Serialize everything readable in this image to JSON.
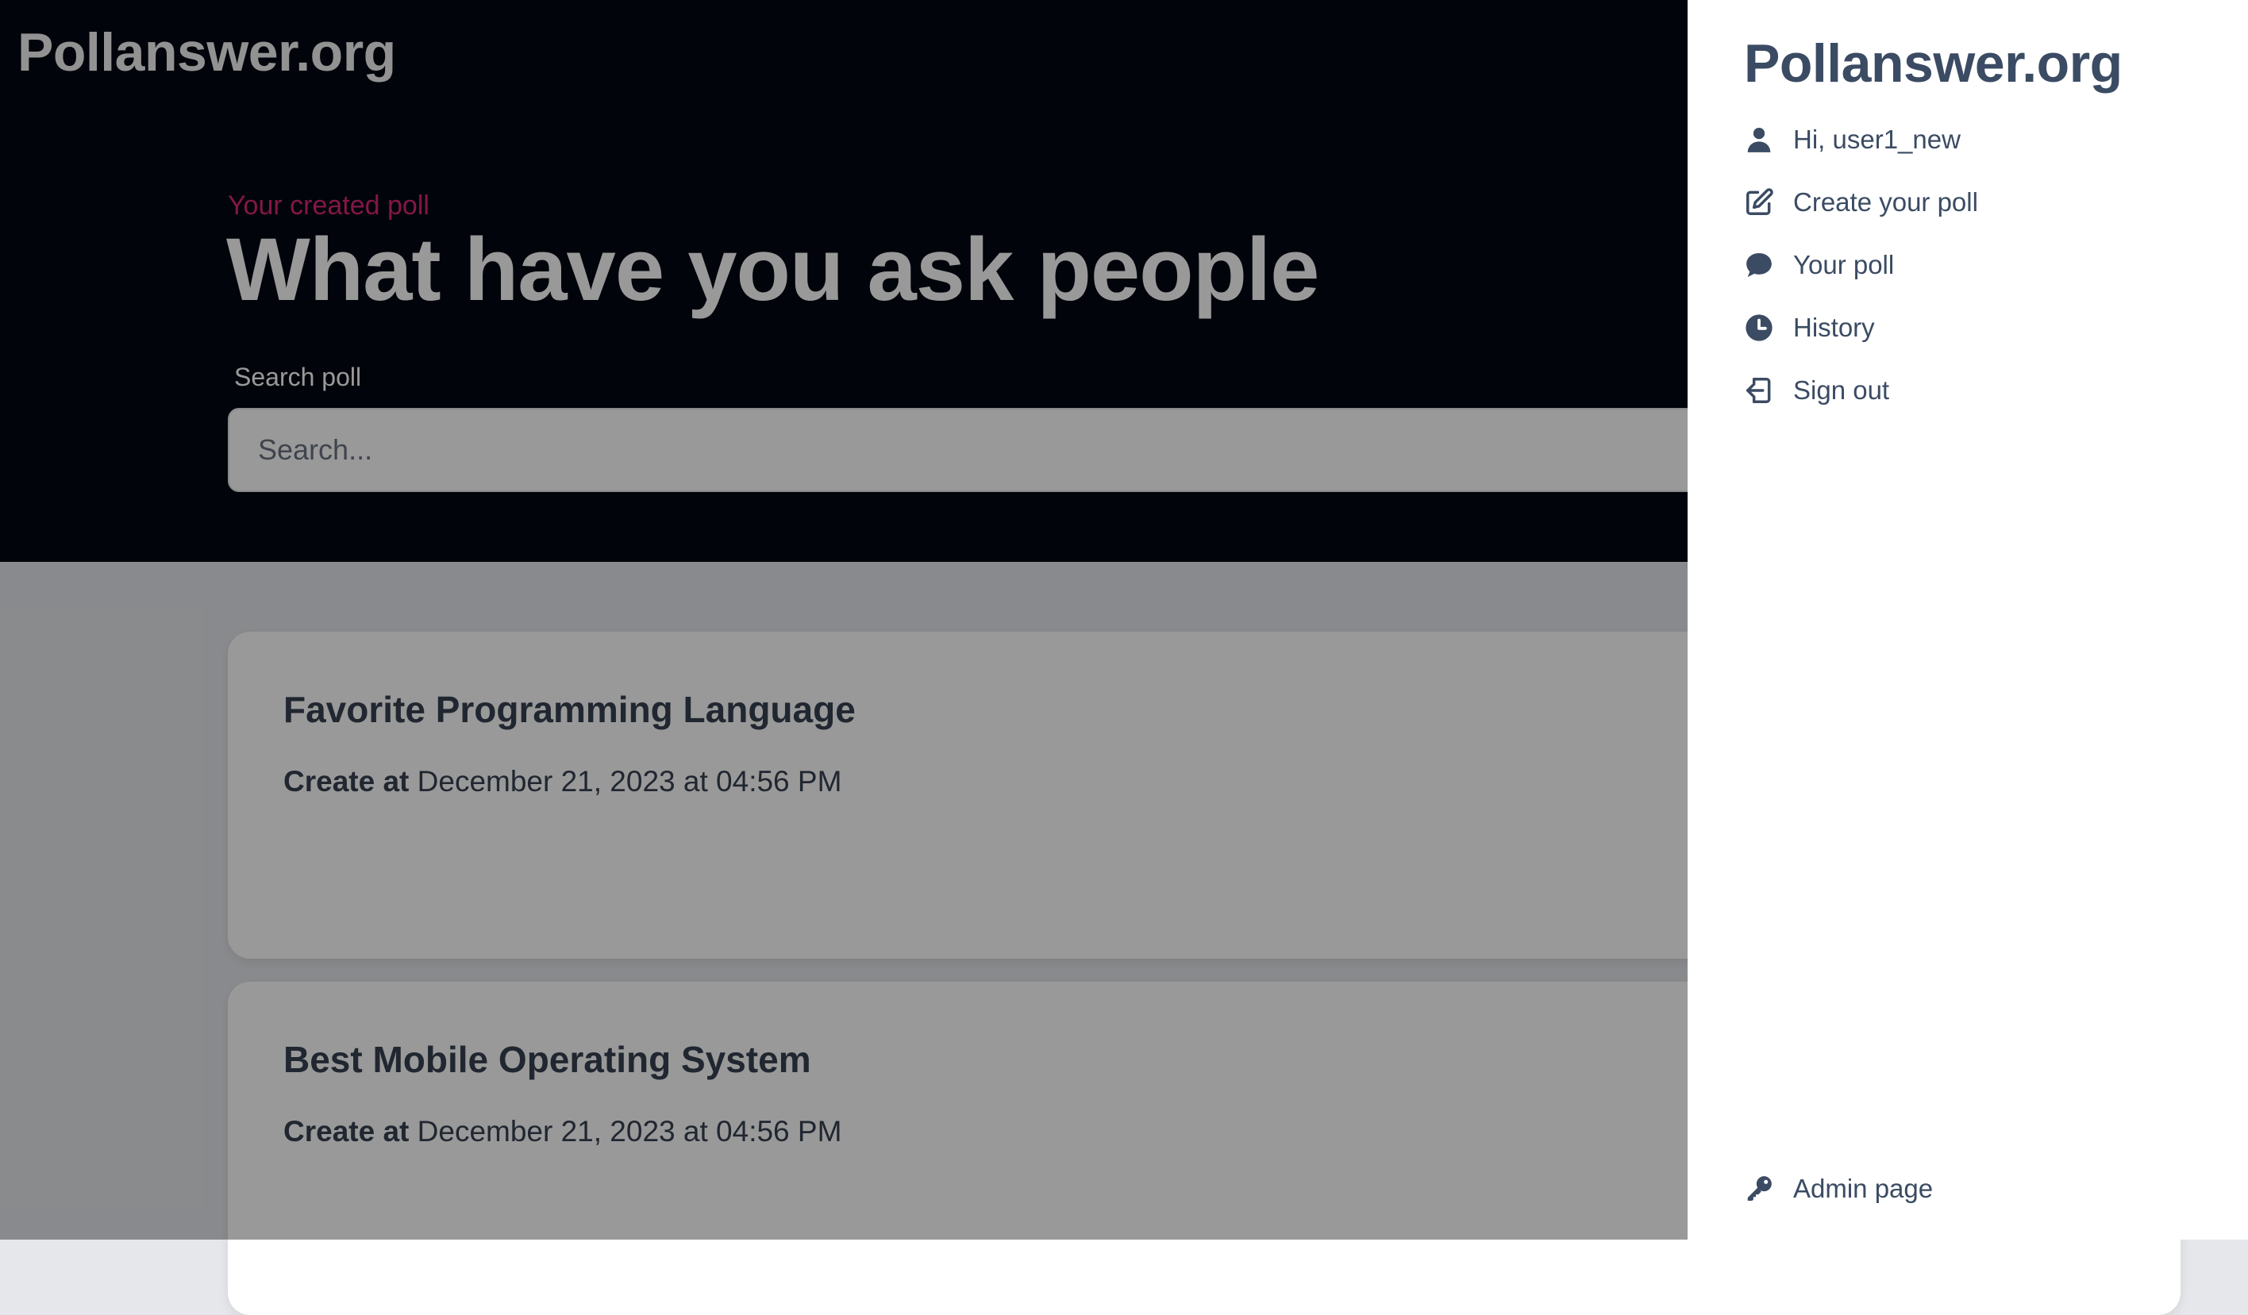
{
  "site": {
    "logo": "Pollanswer.org"
  },
  "hero": {
    "eyebrow": "Your created poll",
    "title": "What have you ask people",
    "search_label": "Search poll",
    "search_placeholder": "Search..."
  },
  "polls": [
    {
      "title": "Favorite Programming Language",
      "created_label": "Create at",
      "created_at": "December 21, 2023 at 04:56 PM"
    },
    {
      "title": "Best Mobile Operating System",
      "created_label": "Create at",
      "created_at": "December 21, 2023 at 04:56 PM"
    }
  ],
  "drawer": {
    "logo": "Pollanswer.org",
    "greeting": "Hi, user1_new",
    "items": [
      {
        "label": "Create your poll",
        "icon": "edit-icon"
      },
      {
        "label": "Your poll",
        "icon": "chat-icon"
      },
      {
        "label": "History",
        "icon": "clock-icon"
      },
      {
        "label": "Sign out",
        "icon": "sign-out-icon"
      }
    ],
    "admin_label": "Admin page"
  },
  "colors": {
    "hero_bg": "#030712",
    "eyebrow": "#db2777",
    "drawer_text": "#3b4b63",
    "overlay": "rgba(0,0,0,0.4)"
  }
}
